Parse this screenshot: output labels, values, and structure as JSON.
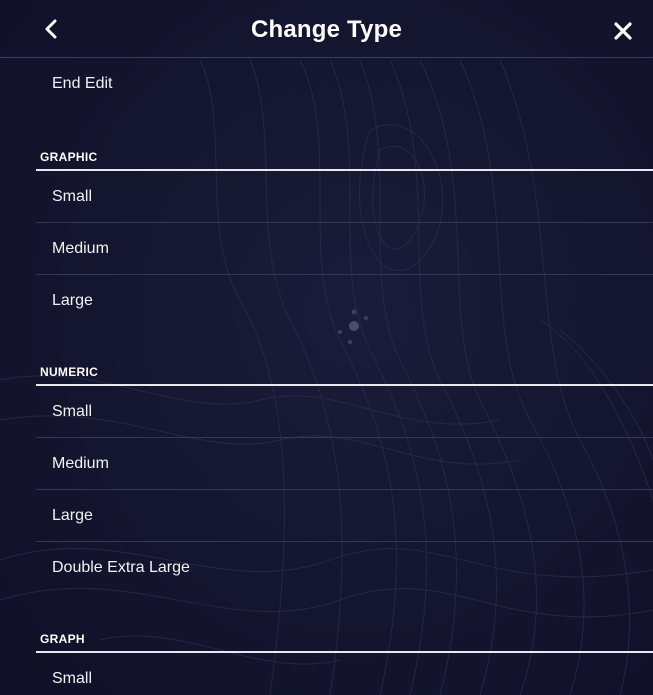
{
  "header": {
    "title": "Change Type",
    "back_icon": "chevron-left-icon",
    "close_icon": "close-icon"
  },
  "top_items": [
    {
      "label": "End Edit"
    }
  ],
  "sections": {
    "graphic": {
      "label": "GRAPHIC",
      "items": [
        "Small",
        "Medium",
        "Large"
      ]
    },
    "numeric": {
      "label": "NUMERIC",
      "items": [
        "Small",
        "Medium",
        "Large",
        "Double Extra Large"
      ]
    },
    "graph": {
      "label": "GRAPH",
      "items": [
        "Small"
      ]
    }
  },
  "colors": {
    "background": "#14152e",
    "text": "#ffffff",
    "separator": "#34375a",
    "section_rule": "#e8e8ee"
  },
  "loading_indicator": "spinner-icon"
}
